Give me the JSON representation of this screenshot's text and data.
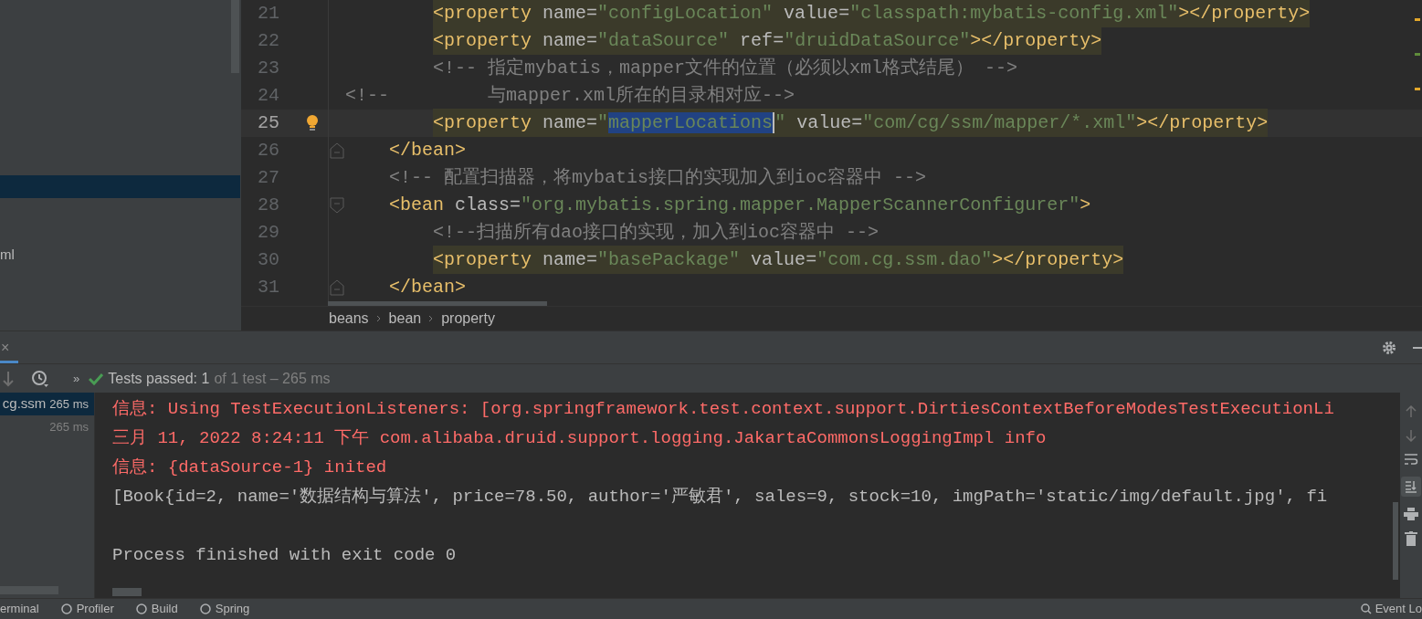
{
  "project_panel": {
    "items": [
      {
        "selected": true
      },
      {
        "label": "ml",
        "selected": false
      }
    ]
  },
  "editor": {
    "lines": [
      {
        "number": "21",
        "current": false,
        "highlighted": true,
        "bulb": false,
        "fold_start": false,
        "fold_end": false,
        "segments": [
          {
            "kind": "tag",
            "text": "        <property"
          },
          {
            "kind": "attr",
            "text": " name"
          },
          {
            "kind": "eq",
            "text": "="
          },
          {
            "kind": "value",
            "text": "\"configLocation\""
          },
          {
            "kind": "attr",
            "text": " value"
          },
          {
            "kind": "eq",
            "text": "="
          },
          {
            "kind": "value",
            "text": "\"classpath:mybatis-config.xml\""
          },
          {
            "kind": "tag",
            "text": "></property>"
          }
        ]
      },
      {
        "number": "22",
        "current": false,
        "highlighted": true,
        "bulb": false,
        "fold_start": false,
        "fold_end": false,
        "segments": [
          {
            "kind": "tag",
            "text": "        <property"
          },
          {
            "kind": "attr",
            "text": " name"
          },
          {
            "kind": "eq",
            "text": "="
          },
          {
            "kind": "value",
            "text": "\"dataSource\""
          },
          {
            "kind": "attr",
            "text": " ref"
          },
          {
            "kind": "eq",
            "text": "="
          },
          {
            "kind": "value",
            "text": "\"druidDataSource\""
          },
          {
            "kind": "tag",
            "text": "></property>"
          }
        ]
      },
      {
        "number": "23",
        "current": false,
        "highlighted": false,
        "bulb": false,
        "fold_start": false,
        "fold_end": false,
        "segments": [
          {
            "kind": "comment",
            "text": "        <!-- 指定mybatis，mapper文件的位置（必须以xml格式结尾） -->"
          }
        ]
      },
      {
        "number": "24",
        "current": false,
        "highlighted": false,
        "bulb": false,
        "fold_start": false,
        "fold_end": false,
        "segments": [
          {
            "kind": "comment",
            "text": "<!--         与mapper.xml所在的目录相对应-->"
          }
        ]
      },
      {
        "number": "25",
        "current": true,
        "highlighted": true,
        "bulb": true,
        "fold_start": false,
        "fold_end": false,
        "segments": [
          {
            "kind": "tag",
            "text": "        <property"
          },
          {
            "kind": "attr",
            "text": " name"
          },
          {
            "kind": "eq",
            "text": "="
          },
          {
            "kind": "value",
            "text": "\""
          },
          {
            "kind": "value",
            "text": "mapperLocations",
            "selected": true
          },
          {
            "kind": "value",
            "text": "\""
          },
          {
            "kind": "attr",
            "text": " value"
          },
          {
            "kind": "eq",
            "text": "="
          },
          {
            "kind": "value",
            "text": "\"com/cg/ssm/mapper/*.xml\""
          },
          {
            "kind": "tag",
            "text": "></property>"
          }
        ]
      },
      {
        "number": "26",
        "current": false,
        "highlighted": false,
        "bulb": false,
        "fold_start": false,
        "fold_end": true,
        "segments": [
          {
            "kind": "tag",
            "text": "    </bean>"
          }
        ]
      },
      {
        "number": "27",
        "current": false,
        "highlighted": false,
        "bulb": false,
        "fold_start": false,
        "fold_end": false,
        "segments": [
          {
            "kind": "comment",
            "text": "    <!-- 配置扫描器，将mybatis接口的实现加入到ioc容器中 -->"
          }
        ]
      },
      {
        "number": "28",
        "current": false,
        "highlighted": false,
        "bulb": false,
        "fold_start": true,
        "fold_end": false,
        "segments": [
          {
            "kind": "tag",
            "text": "    <bean"
          },
          {
            "kind": "attr",
            "text": " class"
          },
          {
            "kind": "eq",
            "text": "="
          },
          {
            "kind": "value",
            "text": "\"org.mybatis.spring.mapper.MapperScannerConfigurer\""
          },
          {
            "kind": "tag",
            "text": ">"
          }
        ]
      },
      {
        "number": "29",
        "current": false,
        "highlighted": false,
        "bulb": false,
        "fold_start": false,
        "fold_end": false,
        "segments": [
          {
            "kind": "comment",
            "text": "        <!--扫描所有dao接口的实现，加入到ioc容器中 -->"
          }
        ]
      },
      {
        "number": "30",
        "current": false,
        "highlighted": true,
        "bulb": false,
        "fold_start": false,
        "fold_end": false,
        "segments": [
          {
            "kind": "tag",
            "text": "        <property"
          },
          {
            "kind": "attr",
            "text": " name"
          },
          {
            "kind": "eq",
            "text": "="
          },
          {
            "kind": "value",
            "text": "\"basePackage\""
          },
          {
            "kind": "attr",
            "text": " value"
          },
          {
            "kind": "eq",
            "text": "="
          },
          {
            "kind": "value",
            "text": "\"com.cg.ssm.dao\""
          },
          {
            "kind": "tag",
            "text": "></property>"
          }
        ]
      },
      {
        "number": "31",
        "current": false,
        "highlighted": false,
        "bulb": false,
        "fold_start": false,
        "fold_end": true,
        "segments": [
          {
            "kind": "tag",
            "text": "    </bean>"
          }
        ]
      }
    ]
  },
  "breadcrumbs": [
    "beans",
    "bean",
    "property"
  ],
  "tool_window": {
    "close": "×"
  },
  "test_toolbar": {
    "more": "»",
    "status": "Tests passed: 1",
    "detail": "of 1 test – 265 ms"
  },
  "test_tree": [
    {
      "name": "cg.ssm",
      "time": "265 ms",
      "selected": true
    },
    {
      "time": "265 ms",
      "selected": false
    }
  ],
  "console": {
    "lines": [
      {
        "kind": "error",
        "text": "信息: Using TestExecutionListeners: [org.springframework.test.context.support.DirtiesContextBeforeModesTestExecutionLi"
      },
      {
        "kind": "error",
        "text": "三月 11, 2022 8:24:11 下午 com.alibaba.druid.support.logging.JakartaCommonsLoggingImpl info"
      },
      {
        "kind": "error",
        "text": "信息: {dataSource-1} inited"
      },
      {
        "kind": "output",
        "text": "[Book{id=2, name='数据结构与算法', price=78.50, author='严敏君', sales=9, stock=10, imgPath='static/img/default.jpg', fi"
      },
      {
        "kind": "blank"
      },
      {
        "kind": "output",
        "text": "Process finished with exit code 0"
      }
    ]
  },
  "bottom_tabs": [
    {
      "label": "erminal"
    },
    {
      "label": "Profiler"
    },
    {
      "label": "Build"
    },
    {
      "label": "Spring"
    }
  ],
  "event_log": "Event Lo"
}
